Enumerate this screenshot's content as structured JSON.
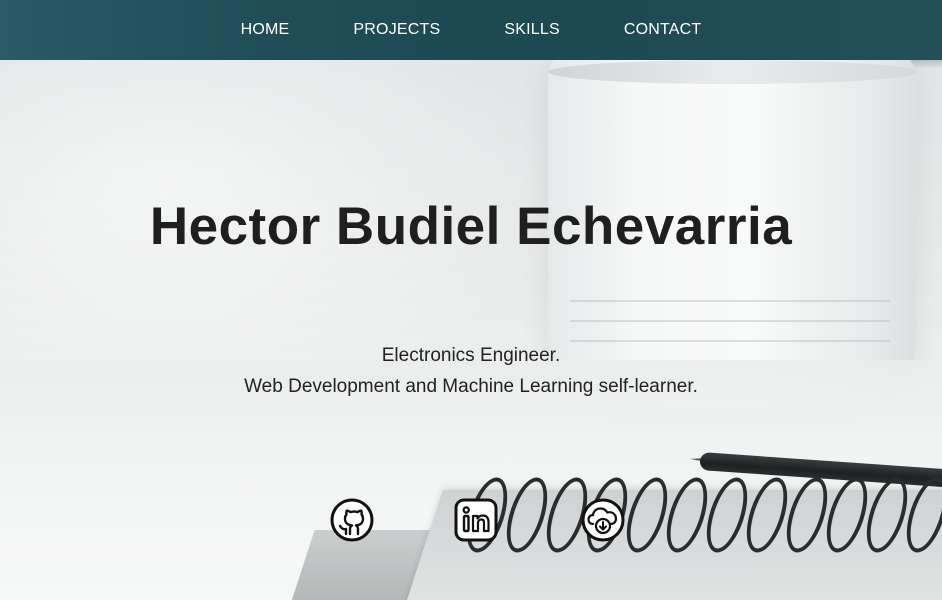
{
  "nav": {
    "items": [
      {
        "label": "HOME"
      },
      {
        "label": "PROJECTS"
      },
      {
        "label": "SKILLS"
      },
      {
        "label": "CONTACT"
      }
    ]
  },
  "hero": {
    "name": "Hector Budiel Echevarria",
    "tagline_line1": "Electronics Engineer.",
    "tagline_line2": "Web Development and Machine Learning self-learner."
  },
  "social": {
    "icons": [
      "github-icon",
      "linkedin-icon",
      "cloud-download-icon"
    ]
  },
  "colors": {
    "navbar": "#1f4c57",
    "nav_text": "#ffffff",
    "heading": "#1f1f1f"
  }
}
